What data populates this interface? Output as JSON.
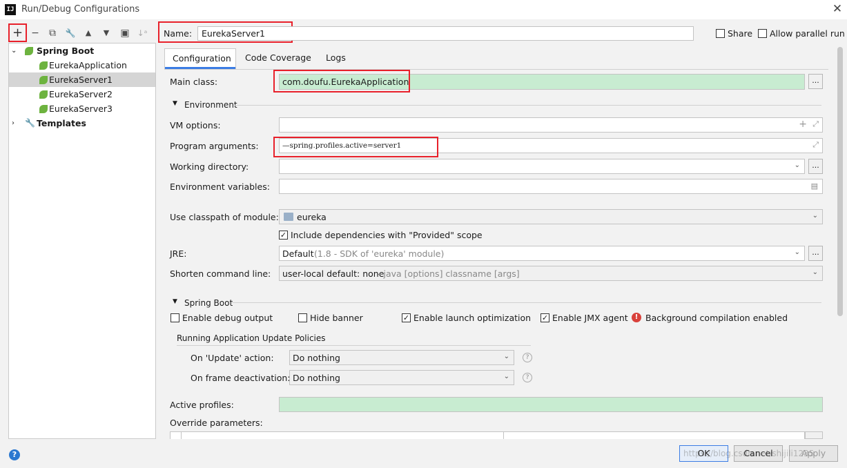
{
  "window": {
    "title": "Run/Debug Configurations",
    "app_icon_text": "IJ",
    "close_glyph": "✕"
  },
  "toolbar": {
    "add": "+",
    "remove": "−",
    "copy": "⧉",
    "edit": "🔧",
    "up": "▲",
    "down": "▼",
    "folder": "▣",
    "sort": "↓ᵃ"
  },
  "tree": {
    "spring_boot": "Spring Boot",
    "items": [
      "EurekaApplication",
      "EurekaServer1",
      "EurekaServer2",
      "EurekaServer3"
    ],
    "templates": "Templates"
  },
  "header": {
    "name_label": "Name:",
    "name_value": "EurekaServer1",
    "share_label": "Share",
    "parallel_label": "Allow parallel run"
  },
  "tabs": [
    "Configuration",
    "Code Coverage",
    "Logs"
  ],
  "form": {
    "main_class_label": "Main class:",
    "main_class_value": "com.doufu.EurekaApplication",
    "environment_section": "Environment",
    "vm_options_label": "VM options:",
    "program_args_label": "Program arguments:",
    "program_args_value": "—spring.profiles.active=server1",
    "working_dir_label": "Working directory:",
    "env_vars_label": "Environment variables:",
    "classpath_label": "Use classpath of module:",
    "classpath_value": "eureka",
    "include_deps_label": "Include dependencies with \"Provided\" scope",
    "jre_label": "JRE:",
    "jre_value": "Default",
    "jre_hint": "(1.8 - SDK of 'eureka' module)",
    "shorten_label": "Shorten command line:",
    "shorten_value": "user-local default: none",
    "shorten_hint": " - java [options] classname [args]"
  },
  "spring_boot_section": {
    "title": "Spring Boot",
    "debug_output": "Enable debug output",
    "hide_banner": "Hide banner",
    "launch_opt": "Enable launch optimization",
    "jmx": "Enable JMX agent",
    "bg_compilation": "Background compilation enabled",
    "update_policies": "Running Application Update Policies",
    "update_action_label": "On 'Update' action:",
    "update_action_value": "Do nothing",
    "frame_deactivation_label": "On frame deactivation:",
    "frame_deactivation_value": "Do nothing",
    "active_profiles_label": "Active profiles:",
    "override_params_label": "Override parameters:"
  },
  "footer": {
    "ok": "OK",
    "cancel": "Cancel",
    "apply": "Apply",
    "watermark": "https://blog.csdn.net/shijili1235"
  },
  "colors": {
    "highlight_red": "#e8202a",
    "field_green": "#c8ecd1",
    "spring_green": "#6db33f",
    "help_blue": "#2a78d0"
  }
}
